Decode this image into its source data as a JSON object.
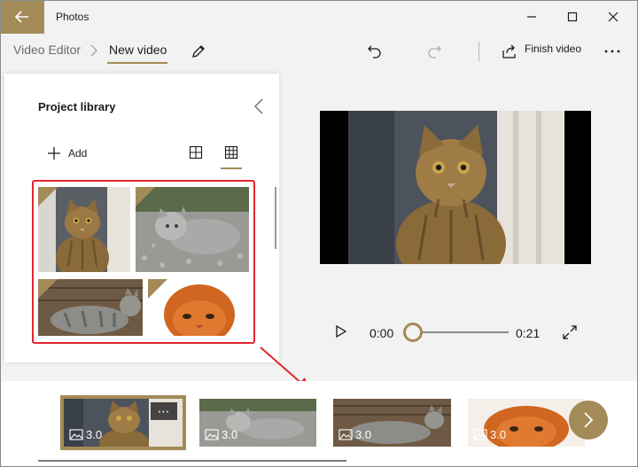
{
  "window": {
    "title": "Photos",
    "accent": "#a38b58"
  },
  "breadcrumb": {
    "root": "Video Editor",
    "current": "New video"
  },
  "toolbar": {
    "finish_label": "Finish video"
  },
  "library": {
    "title": "Project library",
    "add_label": "Add",
    "items": [
      {
        "name": "cat-portrait"
      },
      {
        "name": "grey-cat-lying"
      },
      {
        "name": "tabby-cat-walking"
      },
      {
        "name": "orange-kitten"
      }
    ]
  },
  "player": {
    "time_current": "0:00",
    "time_total": "0:21",
    "progress": 0.0
  },
  "storyboard": {
    "clips": [
      {
        "duration": "3.0",
        "selected": true
      },
      {
        "duration": "3.0",
        "selected": false
      },
      {
        "duration": "3.0",
        "selected": false
      },
      {
        "duration": "3.0",
        "selected": false
      }
    ],
    "more_label": "⋯"
  },
  "annotation_color": "#e0282e"
}
